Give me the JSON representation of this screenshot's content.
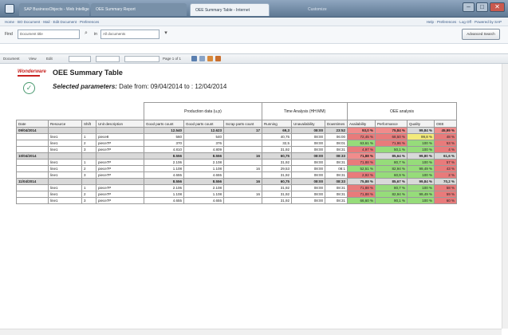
{
  "window": {
    "tabs": [
      "SAP BusinessObjects - Web Intelligence",
      "OEE Summary Report",
      "OEE Summary Table - Internet",
      "Customize"
    ],
    "controls": [
      "–",
      "□",
      "✕"
    ]
  },
  "linkbar": {
    "left": "Home · BO Document · Mail · Edit Document · Preferences",
    "right": "Help · Preferences · Log Off · Powered by SAP"
  },
  "search": {
    "label": "Find",
    "value": "",
    "placeholder": "Document title",
    "label2": "in",
    "value2": "All documents",
    "button": "Advanced Search"
  },
  "toolbar": {
    "items": [
      "Document",
      "View",
      "Edit",
      "Refresh Data",
      "Page 1 of 1",
      "Track changes"
    ]
  },
  "report": {
    "logo": "Wonderware",
    "title": "OEE Summary Table",
    "params_label": "Selected parameters:",
    "params_value": " Date from: 09/04/2014 to : 12/04/2014"
  },
  "table": {
    "groups": [
      "Production data (u.p)",
      "Time Analysis (HH:MM)",
      "OEE analysis"
    ],
    "headers": [
      "Date",
      "Resource",
      "Shift",
      "Unit description",
      "Good parts count",
      "Good parts count",
      "Scrap parts count",
      "Running",
      "Unavailability",
      "Downtimes",
      "Availability",
      "Performance",
      "Quality",
      "OEE"
    ],
    "sections": [
      {
        "date": "09/04/2014",
        "summary": [
          "12.540",
          "12.623",
          "17",
          "69,3",
          "08:00",
          "23:52",
          "93,0 %",
          "75,84 %",
          "99,84 %",
          "45,99 %"
        ],
        "summary_colors": [
          "",
          "",
          "",
          "",
          "",
          "",
          "red",
          "red",
          "",
          "red"
        ],
        "rows": [
          {
            "resource": "line1",
            "shift": "1",
            "unit": "piece8",
            "values": [
              "560",
              "540",
              "",
              "40,75",
              "08:00",
              "06:00",
              "72,45 %",
              "68,50 %",
              "99,8 %",
              "48 %"
            ],
            "colors": [
              "",
              "",
              "",
              "",
              "",
              "",
              "red",
              "red",
              "yellow",
              "red"
            ]
          },
          {
            "resource": "line1",
            "shift": "2",
            "unit": "piece7P",
            "values": [
              "370",
              "376",
              "",
              "32,5",
              "08:00",
              "08:01",
              "63,61 %",
              "71,96 %",
              "100 %",
              "53 %"
            ],
            "colors": [
              "",
              "",
              "",
              "",
              "",
              "",
              "green",
              "red",
              "green",
              "red"
            ]
          },
          {
            "resource": "line1",
            "shift": "3",
            "unit": "piece7P",
            "values": [
              "4.810",
              "4.809",
              "",
              "31,92",
              "08:00",
              "08:31",
              "4,97 %",
              "50,1 %",
              "100 %",
              "4 %"
            ],
            "colors": [
              "",
              "",
              "",
              "",
              "",
              "",
              "red",
              "green",
              "green",
              "red"
            ]
          }
        ]
      },
      {
        "date": "10/04/2014",
        "summary": [
          "8.556",
          "8.556",
          "16",
          "60,75",
          "08:00",
          "08:33",
          "71,88 %",
          "85,64 %",
          "99,80 %",
          "61,6 %"
        ],
        "summary_colors": [
          "",
          "",
          "",
          "",
          "",
          "",
          "red",
          "",
          "",
          ""
        ],
        "rows": [
          {
            "resource": "line1",
            "shift": "1",
            "unit": "piece7P",
            "values": [
              "2.106",
              "2.108",
              "",
              "31,92",
              "08:00",
              "08:31",
              "71,88 %",
              "80,7 %",
              "100 %",
              "57 %"
            ],
            "colors": [
              "",
              "",
              "",
              "",
              "",
              "",
              "red",
              "green",
              "green",
              "red"
            ]
          },
          {
            "resource": "line1",
            "shift": "2",
            "unit": "piece7P",
            "values": [
              "1.108",
              "1.108",
              "16",
              "29,53",
              "08:00",
              "08:1",
              "52,51 %",
              "82,94 %",
              "99,49 %",
              "43 %"
            ],
            "colors": [
              "",
              "",
              "",
              "",
              "",
              "",
              "green",
              "green",
              "green",
              "red"
            ]
          },
          {
            "resource": "line1",
            "shift": "3",
            "unit": "piece7P",
            "values": [
              "4.655",
              "4.655",
              "",
              "31,92",
              "08:00",
              "08:31",
              "2,92 %",
              "60,9 %",
              "100 %",
              "2 %"
            ],
            "colors": [
              "",
              "",
              "",
              "",
              "",
              "",
              "red",
              "green",
              "green",
              "red"
            ]
          }
        ]
      },
      {
        "date": "11/04/2014",
        "summary": [
          "8.556",
          "8.556",
          "16",
          "60,75",
          "08:00",
          "08:33",
          "75,88 %",
          "85,67 %",
          "99,84 %",
          "70,2 %"
        ],
        "summary_colors": [
          "",
          "",
          "",
          "",
          "",
          "",
          "",
          "",
          "",
          ""
        ],
        "rows": [
          {
            "resource": "line1",
            "shift": "1",
            "unit": "piece7P",
            "values": [
              "2.106",
              "2.108",
              "",
              "31,92",
              "08:00",
              "08:31",
              "71,88 %",
              "80,7 %",
              "100 %",
              "58 %"
            ],
            "colors": [
              "",
              "",
              "",
              "",
              "",
              "",
              "red",
              "green",
              "green",
              "red"
            ]
          },
          {
            "resource": "line1",
            "shift": "2",
            "unit": "piece7P",
            "values": [
              "1.108",
              "1.108",
              "16",
              "31,92",
              "08:00",
              "08:31",
              "71,88 %",
              "82,94 %",
              "99,49 %",
              "59 %"
            ],
            "colors": [
              "",
              "",
              "",
              "",
              "",
              "",
              "red",
              "green",
              "green",
              "red"
            ]
          },
          {
            "resource": "line1",
            "shift": "3",
            "unit": "piece7P",
            "values": [
              "4.655",
              "4.655",
              "",
              "31,92",
              "08:00",
              "08:31",
              "66,60 %",
              "90,1 %",
              "100 %",
              "60 %"
            ],
            "colors": [
              "",
              "",
              "",
              "",
              "",
              "",
              "green",
              "green",
              "green",
              "red"
            ]
          }
        ]
      }
    ]
  }
}
